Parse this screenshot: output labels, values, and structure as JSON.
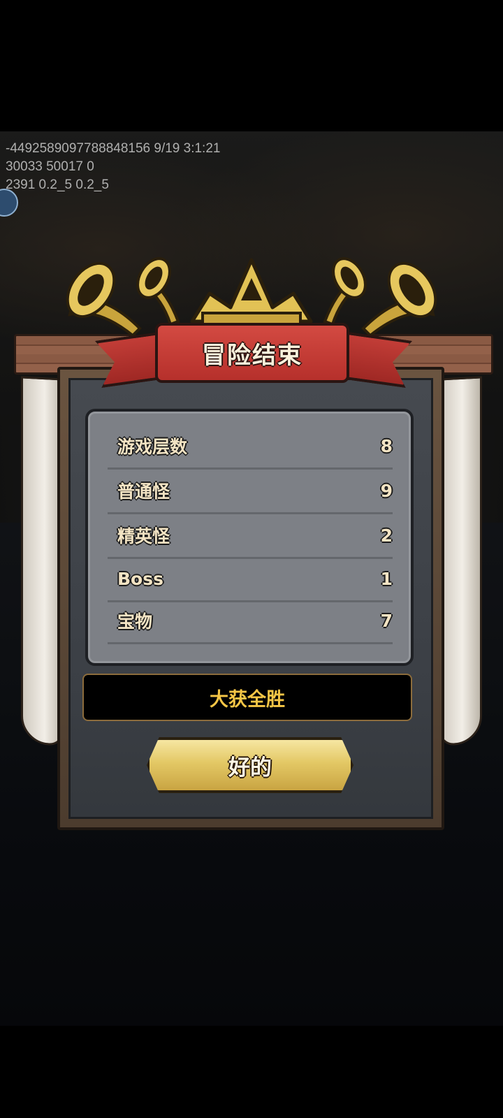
{
  "debug": {
    "line1": "-4492589097788848156 9/19 3:1:21",
    "line2": "30033 50017 0",
    "line3": "2391 0.2_5 0.2_5"
  },
  "dialog": {
    "title": "冒险结束",
    "stats": [
      {
        "label": "游戏层数",
        "value": "8"
      },
      {
        "label": "普通怪",
        "value": "9"
      },
      {
        "label": "精英怪",
        "value": "2"
      },
      {
        "label": "Boss",
        "value": "1"
      },
      {
        "label": "宝物",
        "value": "7"
      }
    ],
    "result": "大获全胜",
    "confirm_label": "好的"
  },
  "colors": {
    "ribbon": "#c23d37",
    "result_text": "#f5c646",
    "button_gold": "#e3c865",
    "panel_gray": "#7d8086"
  },
  "icons": [
    "trumpet-icon",
    "crown-icon",
    "side-badge-icon"
  ]
}
